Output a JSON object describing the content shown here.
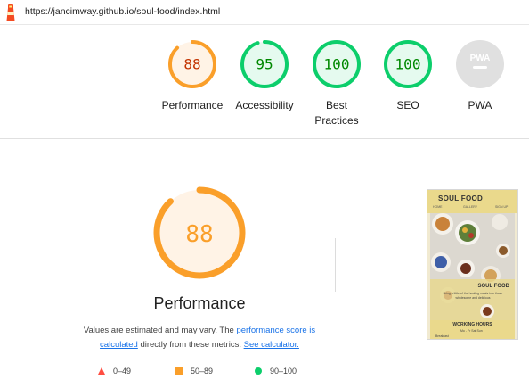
{
  "url": "https://jancimway.github.io/soul-food/index.html",
  "colors": {
    "orange": "#fa9f2a",
    "orange_text": "#c33300",
    "orange_bg": "#fff3e6",
    "green": "#0cce6b",
    "green_text": "#008800",
    "green_bg": "#e5faef",
    "grey": "#bdbdbd",
    "grey_bg": "#e0e0e0",
    "red": "#ff4e42",
    "link": "#1a73e8"
  },
  "gauges": [
    {
      "score": "88",
      "value": 88,
      "label": "Performance",
      "status": "average"
    },
    {
      "score": "95",
      "value": 95,
      "label": "Accessibility",
      "status": "pass"
    },
    {
      "score": "100",
      "value": 100,
      "label": "Best Practices",
      "status": "pass"
    },
    {
      "score": "100",
      "value": 100,
      "label": "SEO",
      "status": "pass"
    },
    {
      "label": "PWA",
      "status": "na",
      "icon": "pwa-badge-icon",
      "icon_text": "PWA"
    }
  ],
  "main": {
    "score": "88",
    "value": 88,
    "title": "Performance",
    "desc_prefix": "Values are estimated and may vary. The ",
    "link_score": "performance score is calculated",
    "desc_middle": " directly from these metrics. ",
    "link_calc": "See calculator."
  },
  "legend": [
    {
      "icon": "triangle-fail-icon",
      "range": "0–49"
    },
    {
      "icon": "square-average-icon",
      "range": "50–89"
    },
    {
      "icon": "circle-pass-icon",
      "range": "90–100"
    }
  ],
  "thumbnail": {
    "title": "SOUL FOOD",
    "nav": [
      "HOME",
      "GALLERY",
      "SIGN UP"
    ],
    "overlay_title": "SOUL FOOD",
    "overlay_text": "Bring a little of the healing meals into those wholesome and delicious",
    "footer_title": "WORKING HOURS",
    "days": "Mo - Fr   Sat   Sun",
    "row_label": "Breakfast"
  }
}
